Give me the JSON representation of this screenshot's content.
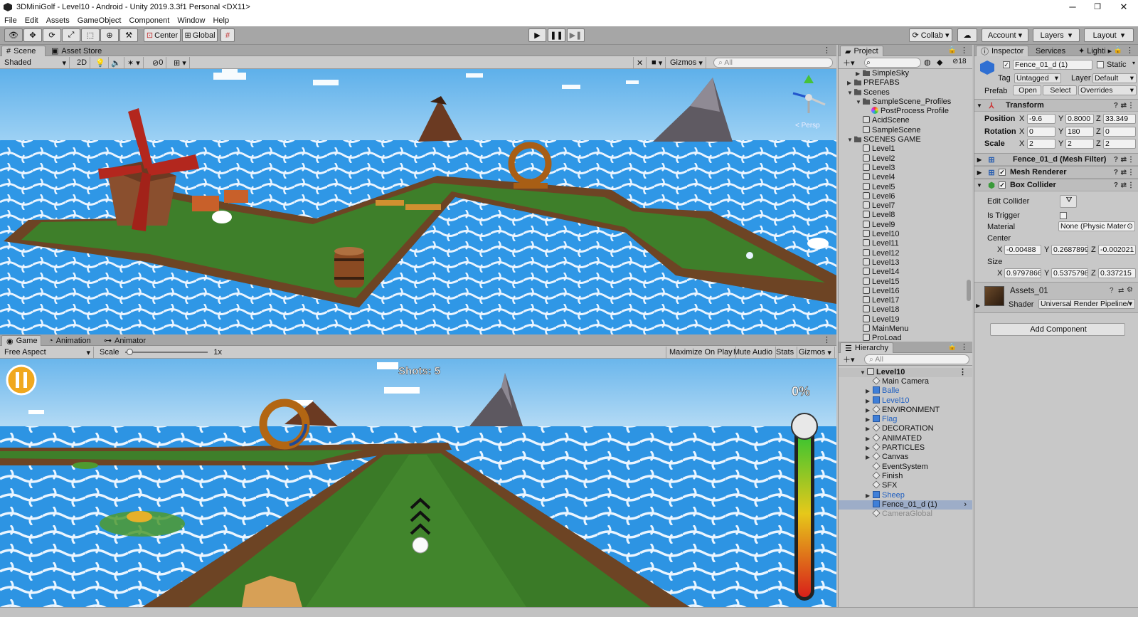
{
  "window": {
    "title": "3DMiniGolf - Level10 - Android - Unity 2019.3.3f1 Personal <DX11>"
  },
  "menu": [
    "File",
    "Edit",
    "Assets",
    "GameObject",
    "Component",
    "Window",
    "Help"
  ],
  "toolbar": {
    "center_label": "Center",
    "global_label": "Global",
    "collab_label": "Collab",
    "account_label": "Account",
    "layers_label": "Layers",
    "layout_label": "Layout"
  },
  "scene_panel": {
    "tabs": [
      "Scene",
      "Asset Store"
    ],
    "shading": "Shaded",
    "mode_2d": "2D",
    "hidden_count": "0",
    "gizmos": "Gizmos",
    "search_placeholder": "All",
    "persp": "< Persp"
  },
  "game_panel": {
    "tabs": [
      "Game",
      "Animation",
      "Animator"
    ],
    "aspect": "Free Aspect",
    "scale_label": "Scale",
    "scale_value": "1x",
    "scale_level": 0.02,
    "buttons": [
      "Maximize On Play",
      "Mute Audio",
      "Stats",
      "Gizmos"
    ],
    "shots": "Shots: 5",
    "power": "0%",
    "power_fill": 0
  },
  "project": {
    "tab": "Project",
    "count": "18",
    "items": [
      {
        "label": "SimpleSky",
        "icon": "folder",
        "level": 1,
        "arrow": "▶"
      },
      {
        "label": "PREFABS",
        "icon": "folder",
        "level": 0,
        "arrow": "▶"
      },
      {
        "label": "Scenes",
        "icon": "folder",
        "level": 0,
        "arrow": "▼"
      },
      {
        "label": "SampleScene_Profiles",
        "icon": "folder",
        "level": 1,
        "arrow": "▼"
      },
      {
        "label": "PostProcess Profile",
        "icon": "profile",
        "level": 2,
        "arrow": ""
      },
      {
        "label": "AcidScene",
        "icon": "scene",
        "level": 1,
        "arrow": ""
      },
      {
        "label": "SampleScene",
        "icon": "scene",
        "level": 1,
        "arrow": ""
      },
      {
        "label": "SCENES GAME",
        "icon": "folder",
        "level": 0,
        "arrow": "▼"
      },
      {
        "label": "Level1",
        "icon": "scene",
        "level": 1,
        "arrow": ""
      },
      {
        "label": "Level2",
        "icon": "scene",
        "level": 1,
        "arrow": ""
      },
      {
        "label": "Level3",
        "icon": "scene",
        "level": 1,
        "arrow": ""
      },
      {
        "label": "Level4",
        "icon": "scene",
        "level": 1,
        "arrow": ""
      },
      {
        "label": "Level5",
        "icon": "scene",
        "level": 1,
        "arrow": ""
      },
      {
        "label": "Level6",
        "icon": "scene",
        "level": 1,
        "arrow": ""
      },
      {
        "label": "Level7",
        "icon": "scene",
        "level": 1,
        "arrow": ""
      },
      {
        "label": "Level8",
        "icon": "scene",
        "level": 1,
        "arrow": ""
      },
      {
        "label": "Level9",
        "icon": "scene",
        "level": 1,
        "arrow": ""
      },
      {
        "label": "Level10",
        "icon": "scene",
        "level": 1,
        "arrow": ""
      },
      {
        "label": "Level11",
        "icon": "scene",
        "level": 1,
        "arrow": ""
      },
      {
        "label": "Level12",
        "icon": "scene",
        "level": 1,
        "arrow": ""
      },
      {
        "label": "Level13",
        "icon": "scene",
        "level": 1,
        "arrow": ""
      },
      {
        "label": "Level14",
        "icon": "scene",
        "level": 1,
        "arrow": ""
      },
      {
        "label": "Level15",
        "icon": "scene",
        "level": 1,
        "arrow": ""
      },
      {
        "label": "Level16",
        "icon": "scene",
        "level": 1,
        "arrow": ""
      },
      {
        "label": "Level17",
        "icon": "scene",
        "level": 1,
        "arrow": ""
      },
      {
        "label": "Level18",
        "icon": "scene",
        "level": 1,
        "arrow": ""
      },
      {
        "label": "Level19",
        "icon": "scene",
        "level": 1,
        "arrow": ""
      },
      {
        "label": "MainMenu",
        "icon": "scene",
        "level": 1,
        "arrow": ""
      },
      {
        "label": "ProLoad",
        "icon": "scene",
        "level": 1,
        "arrow": ""
      }
    ]
  },
  "hierarchy": {
    "tab": "Hierarchy",
    "search_placeholder": "All",
    "root": "Level10",
    "items": [
      {
        "label": "Main Camera",
        "icon": "go",
        "arrow": "",
        "color": "normal"
      },
      {
        "label": "Balle",
        "icon": "prefab",
        "arrow": "▶",
        "color": "blue"
      },
      {
        "label": "Level10",
        "icon": "prefab",
        "arrow": "▶",
        "color": "blue"
      },
      {
        "label": "ENVIRONMENT",
        "icon": "go",
        "arrow": "▶",
        "color": "normal"
      },
      {
        "label": "Flag",
        "icon": "prefab",
        "arrow": "▶",
        "color": "blue"
      },
      {
        "label": "DECORATION",
        "icon": "go",
        "arrow": "▶",
        "color": "normal"
      },
      {
        "label": "ANIMATED",
        "icon": "go",
        "arrow": "▶",
        "color": "normal"
      },
      {
        "label": "PARTICLES",
        "icon": "go",
        "arrow": "▶",
        "color": "normal"
      },
      {
        "label": "Canvas",
        "icon": "go",
        "arrow": "▶",
        "color": "normal"
      },
      {
        "label": "EventSystem",
        "icon": "go",
        "arrow": "",
        "color": "normal"
      },
      {
        "label": "Finish",
        "icon": "go",
        "arrow": "",
        "color": "normal"
      },
      {
        "label": "SFX",
        "icon": "go",
        "arrow": "",
        "color": "normal"
      },
      {
        "label": "Sheep",
        "icon": "prefab",
        "arrow": "▶",
        "color": "blue"
      },
      {
        "label": "Fence_01_d (1)",
        "icon": "prefab",
        "arrow": "",
        "color": "selected"
      },
      {
        "label": "CameraGlobal",
        "icon": "go",
        "arrow": "",
        "color": "gray"
      }
    ]
  },
  "inspector": {
    "tabs": [
      "Inspector",
      "Services",
      "Lighti"
    ],
    "object_name": "Fence_01_d (1)",
    "static_label": "Static",
    "tag_label": "Tag",
    "tag_value": "Untagged",
    "layer_label": "Layer",
    "layer_value": "Default",
    "prefab_label": "Prefab",
    "prefab_open": "Open",
    "prefab_select": "Select",
    "prefab_overrides": "Overrides",
    "transform": {
      "title": "Transform",
      "position": {
        "label": "Position",
        "x": "-9.6",
        "y": "0.8000",
        "z": "33.349"
      },
      "rotation": {
        "label": "Rotation",
        "x": "0",
        "y": "180",
        "z": "0"
      },
      "scale": {
        "label": "Scale",
        "x": "2",
        "y": "2",
        "z": "2"
      }
    },
    "mesh_filter": "Fence_01_d (Mesh Filter)",
    "mesh_renderer": "Mesh Renderer",
    "box_collider": {
      "title": "Box Collider",
      "edit_collider": "Edit Collider",
      "is_trigger": "Is Trigger",
      "material_label": "Material",
      "material_value": "None (Physic Mater",
      "center_label": "Center",
      "center": {
        "x": "-0.00488",
        "y": "0.2687899",
        "z": "-0.002021"
      },
      "size_label": "Size",
      "size": {
        "x": "0.9797866",
        "y": "0.5375798",
        "z": "0.337215"
      }
    },
    "material": {
      "name": "Assets_01",
      "shader_label": "Shader",
      "shader_value": "Universal Render Pipeline/"
    },
    "add_component": "Add Component"
  }
}
